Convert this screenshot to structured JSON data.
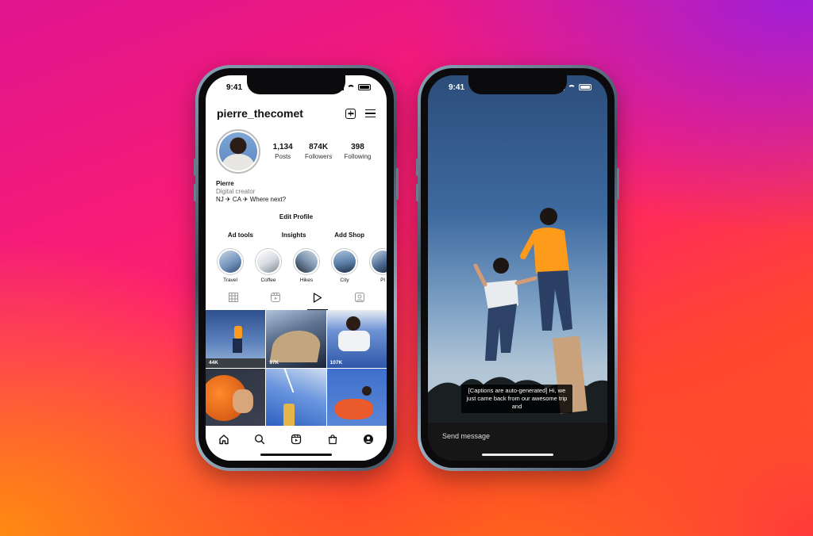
{
  "left_phone": {
    "status": {
      "time": "9:41"
    },
    "header": {
      "username": "pierre_thecomet",
      "new_post_icon": "plus-square-icon",
      "menu_icon": "hamburger-menu-icon"
    },
    "stats": [
      {
        "value": "1,134",
        "label": "Posts"
      },
      {
        "value": "874K",
        "label": "Followers"
      },
      {
        "value": "398",
        "label": "Following"
      }
    ],
    "bio": {
      "name": "Pierre",
      "category": "Digital creator",
      "text": "NJ ✈ CA ✈ Where next?"
    },
    "edit_profile": "Edit Profile",
    "action_buttons": [
      "Ad tools",
      "Insights",
      "Add Shop"
    ],
    "highlights": [
      {
        "label": "Travel",
        "color": "#6f8fb8"
      },
      {
        "label": "Coffee",
        "color": "#d9dde2"
      },
      {
        "label": "Hikes",
        "color": "#7b93ad"
      },
      {
        "label": "City",
        "color": "#5a7ea8"
      },
      {
        "label": "Pl",
        "color": "#4a6a92"
      }
    ],
    "tabs": [
      "grid-icon",
      "reels-icon",
      "play-icon",
      "tagged-icon"
    ],
    "active_tab": "play-icon",
    "grid": [
      {
        "views": "44K",
        "colors": [
          "#3a5f9a",
          "#8fb0d6"
        ]
      },
      {
        "views": "97K",
        "colors": [
          "#1e2b44",
          "#6d7f97"
        ]
      },
      {
        "views": "107K",
        "colors": [
          "#3c63b7",
          "#dfe5f0"
        ]
      },
      {
        "views": "",
        "colors": [
          "#e06a1a",
          "#2b2b2b"
        ]
      },
      {
        "views": "",
        "colors": [
          "#4f7fd0",
          "#c9d7ec"
        ]
      },
      {
        "views": "",
        "colors": [
          "#e6552d",
          "#3a6dc6"
        ]
      }
    ],
    "bottom_nav": [
      "home-icon",
      "search-icon",
      "reels-icon",
      "shop-icon",
      "profile-icon"
    ]
  },
  "right_phone": {
    "status": {
      "time": "9:41"
    },
    "caption": "[Captions are auto-generated] Hi, we just came back from our awesome trip and",
    "send_message": "Send message"
  }
}
